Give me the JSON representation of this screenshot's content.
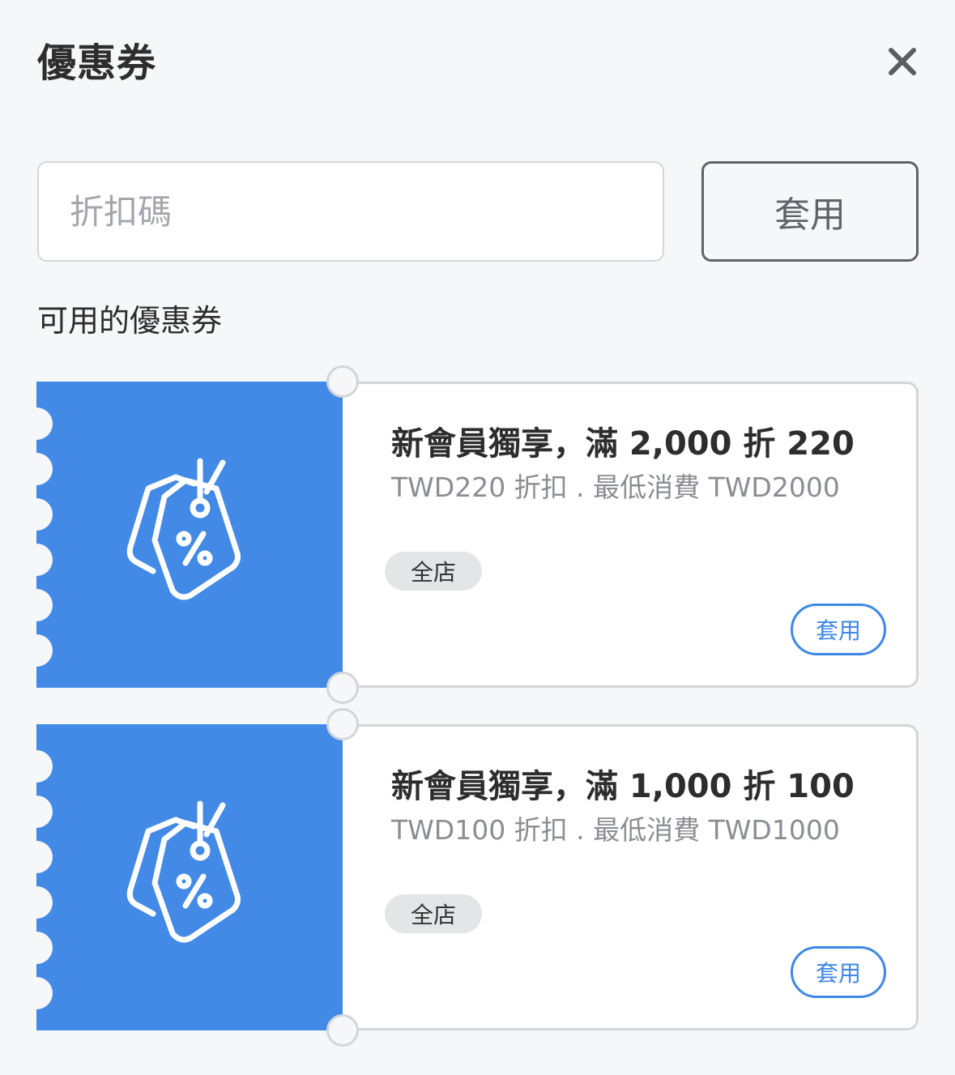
{
  "dialog": {
    "title": "優惠券",
    "close_icon": "close-icon"
  },
  "code_entry": {
    "placeholder": "折扣碼",
    "value": "",
    "apply_label": "套用"
  },
  "section": {
    "title": "可用的優惠券"
  },
  "colors": {
    "accent": "#428ae6",
    "page_bg": "#f6f7f9",
    "border": "#d3d5d9",
    "apply_button_border": "#5f6369"
  },
  "coupons": [
    {
      "icon": "discount-tag-icon",
      "title": "新會員獨享，滿 2,000 折 220",
      "description": "TWD220 折扣 . 最低消費 TWD2000",
      "scope": "全店",
      "apply_label": "套用"
    },
    {
      "icon": "discount-tag-icon",
      "title": "新會員獨享，滿 1,000 折 100",
      "description": "TWD100 折扣 . 最低消費 TWD1000",
      "scope": "全店",
      "apply_label": "套用"
    }
  ]
}
